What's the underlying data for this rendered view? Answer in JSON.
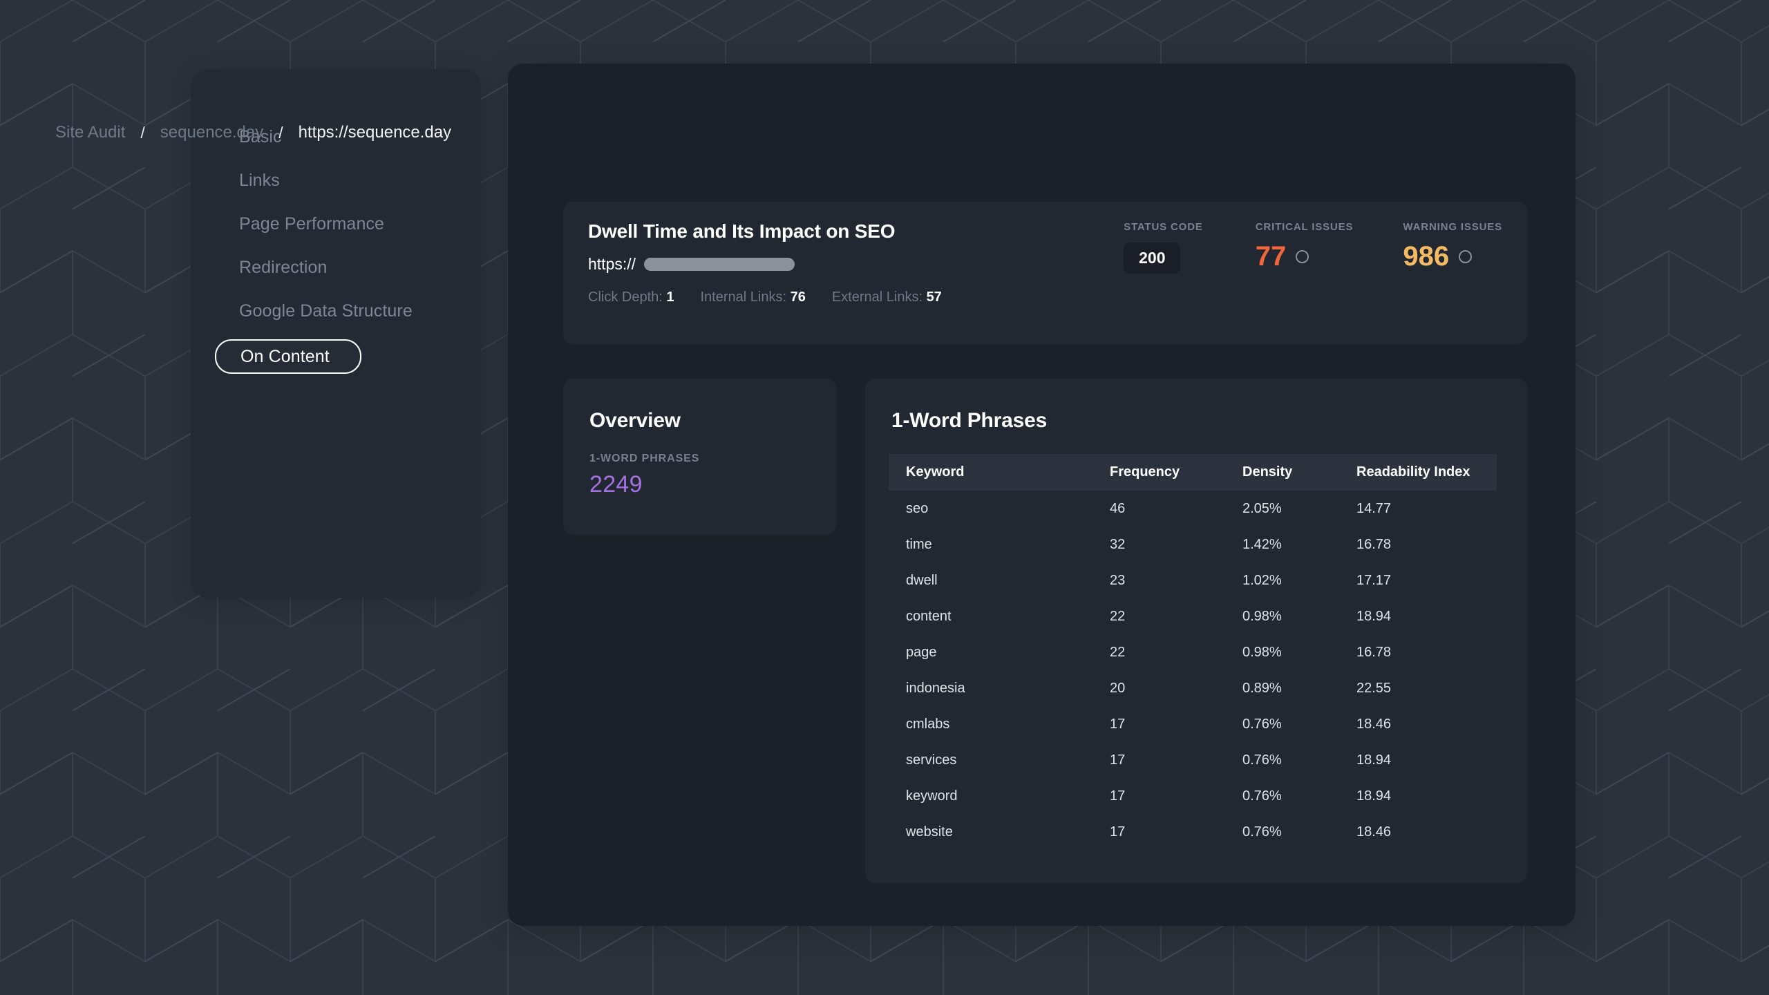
{
  "theme": {
    "page_bg": "#2c323c",
    "panel_bg": "#1b2029",
    "card_bg": "#222832",
    "accent_purple": "#a472e0",
    "critical_color": "#f2663c",
    "warning_color": "#f5bb62",
    "muted_text": "#6f7885"
  },
  "sidebar": {
    "items": [
      {
        "label": "Basic",
        "active": false
      },
      {
        "label": "Links",
        "active": false
      },
      {
        "label": "Page Performance",
        "active": false
      },
      {
        "label": "Redirection",
        "active": false
      },
      {
        "label": "Google Data Structure",
        "active": false
      },
      {
        "label": "On Content",
        "active": true
      }
    ]
  },
  "breadcrumb": {
    "separator": "/",
    "items": [
      {
        "label": "Site Audit",
        "current": false
      },
      {
        "label": "sequence.day",
        "current": false
      },
      {
        "label": "https://sequence.day",
        "current": true
      }
    ]
  },
  "summary": {
    "title": "Dwell Time and Its Impact on SEO",
    "url_scheme": "https://",
    "url_redacted": true,
    "meta": [
      {
        "label": "Click Depth:",
        "value": "1"
      },
      {
        "label": "Internal Links:",
        "value": "76"
      },
      {
        "label": "External Links:",
        "value": "57"
      }
    ],
    "stats": [
      {
        "name": "status-code",
        "label": "STATUS CODE",
        "value": "200",
        "style": "pill",
        "ring": false
      },
      {
        "name": "critical-issues",
        "label": "CRITICAL ISSUES",
        "value": "77",
        "style": "critical",
        "ring": true
      },
      {
        "name": "warning-issues",
        "label": "WARNING ISSUES",
        "value": "986",
        "style": "warning",
        "ring": true
      }
    ]
  },
  "overview": {
    "title": "Overview",
    "metric_label": "1-WORD PHRASES",
    "metric_value": "2249"
  },
  "phrases": {
    "title": "1-Word Phrases",
    "columns": [
      "Keyword",
      "Frequency",
      "Density",
      "Readability Index"
    ],
    "rows": [
      {
        "keyword": "seo",
        "frequency": "46",
        "density": "2.05%",
        "readability": "14.77"
      },
      {
        "keyword": "time",
        "frequency": "32",
        "density": "1.42%",
        "readability": "16.78"
      },
      {
        "keyword": "dwell",
        "frequency": "23",
        "density": "1.02%",
        "readability": "17.17"
      },
      {
        "keyword": "content",
        "frequency": "22",
        "density": "0.98%",
        "readability": "18.94"
      },
      {
        "keyword": "page",
        "frequency": "22",
        "density": "0.98%",
        "readability": "16.78"
      },
      {
        "keyword": "indonesia",
        "frequency": "20",
        "density": "0.89%",
        "readability": "22.55"
      },
      {
        "keyword": "cmlabs",
        "frequency": "17",
        "density": "0.76%",
        "readability": "18.46"
      },
      {
        "keyword": "services",
        "frequency": "17",
        "density": "0.76%",
        "readability": "18.94"
      },
      {
        "keyword": "keyword",
        "frequency": "17",
        "density": "0.76%",
        "readability": "18.94"
      },
      {
        "keyword": "website",
        "frequency": "17",
        "density": "0.76%",
        "readability": "18.46"
      }
    ]
  }
}
